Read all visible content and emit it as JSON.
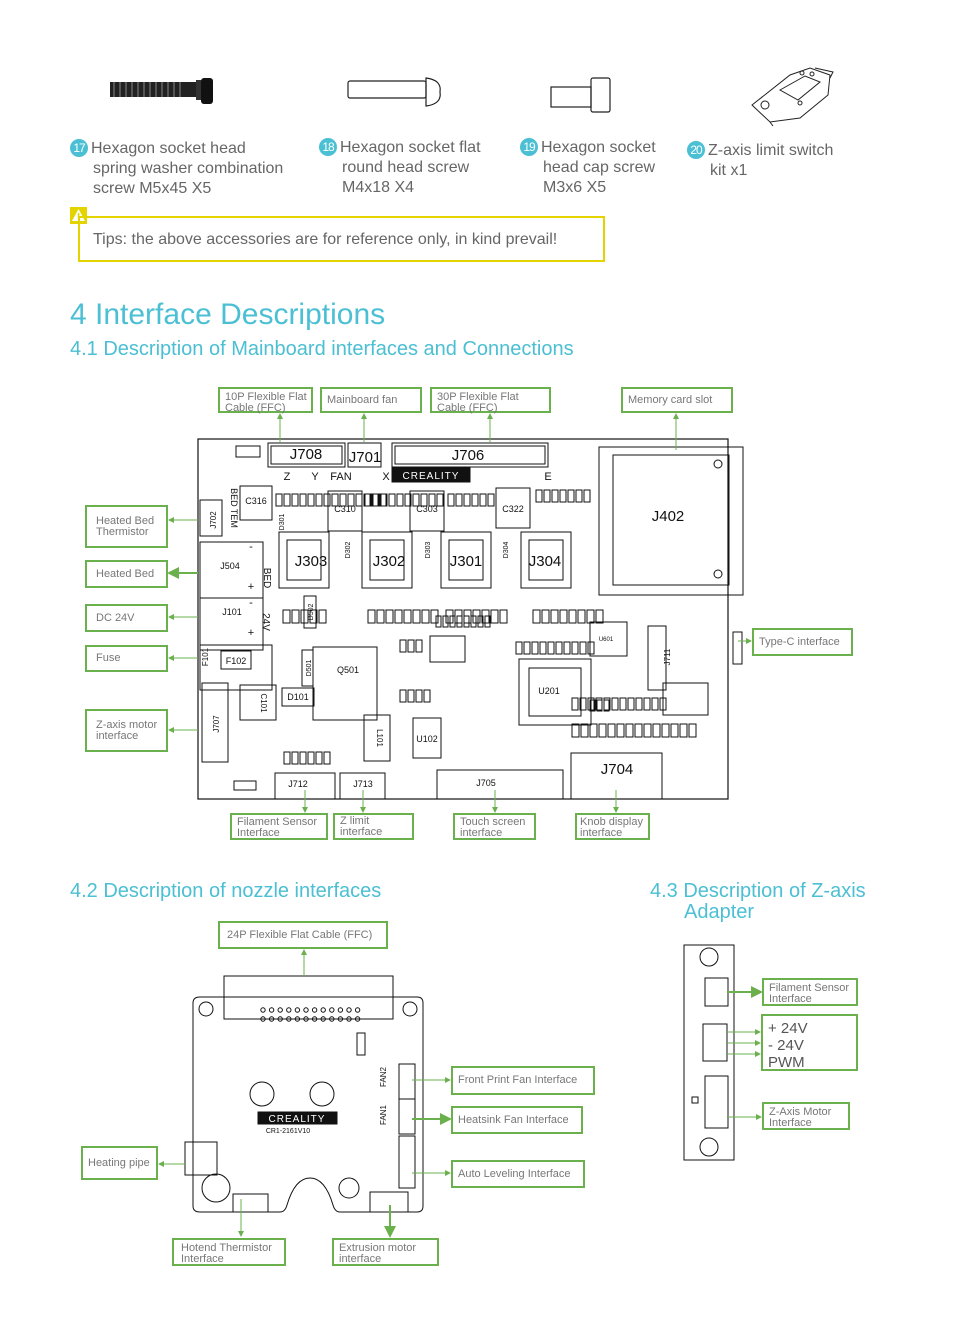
{
  "accessories": [
    {
      "number": "17",
      "lines": [
        "Hexagon socket head",
        "spring washer combination",
        "screw M5x45 X5"
      ],
      "icon": "hex-socket-washer-screw"
    },
    {
      "number": "18",
      "lines": [
        "Hexagon socket flat",
        "round head screw",
        "M4x18 X4"
      ],
      "icon": "flat-round-head-screw"
    },
    {
      "number": "19",
      "lines": [
        "Hexagon socket",
        "head cap screw",
        "M3x6 X5"
      ],
      "icon": "cap-screw"
    },
    {
      "number": "20",
      "lines": [
        "Z-axis limit switch",
        "kit x1"
      ],
      "icon": "limit-switch"
    }
  ],
  "tips": {
    "icon": "warning-icon",
    "text": "Tips: the above accessories are for reference only, in kind prevail!"
  },
  "section": {
    "title": "4 Interface Descriptions"
  },
  "mainboard": {
    "title": "4.1 Description of Mainboard interfaces and Connections",
    "labels": {
      "ffc10": [
        "10P Flexible Flat",
        "Cable (FFC)"
      ],
      "fan": "Mainboard fan",
      "ffc30": [
        "30P Flexible Flat",
        "Cable (FFC)"
      ],
      "memory": "Memory card slot",
      "bed_therm": [
        "Heated Bed",
        "Thermistor"
      ],
      "bed": "Heated Bed",
      "dc": "DC 24V",
      "fuse": "Fuse",
      "zmotor": [
        "Z-axis motor",
        "interface"
      ],
      "typec": "Type-C interface",
      "filament": [
        "Filament Sensor",
        "Interface"
      ],
      "zlimit": "Z limit interface",
      "touch": [
        "Touch screen",
        "interface"
      ],
      "knob": [
        "Knob display",
        "interface"
      ]
    },
    "silk": {
      "J708": "J708",
      "J701": "J701",
      "J706": "J706",
      "J402": "J402",
      "J303": "J303",
      "J302": "J302",
      "J301": "J301",
      "J304": "J304",
      "C316": "C316",
      "C310": "C310",
      "C303": "C303",
      "C322": "C322",
      "J504": "J504",
      "J101": "J101",
      "F102": "F102",
      "F101": "F101",
      "Q501": "Q501",
      "D501": "D501",
      "D502": "D502",
      "U201": "U201",
      "U601": "U601",
      "J711": "J711",
      "D101": "D101",
      "C101": "C101",
      "J707": "J707",
      "J702": "J702",
      "L101": "L101",
      "U102": "U102",
      "J712": "J712",
      "J713": "J713",
      "J705": "J705",
      "J704": "J704",
      "D301": "D301",
      "D302": "D302",
      "D303": "D303",
      "D304": "D304",
      "Z": "Z",
      "Y": "Y",
      "FAN": "FAN",
      "X": "X",
      "E": "E",
      "BED_TEM": "BED TEM",
      "BED": "BED",
      "V24": "24V",
      "plus": "+",
      "minus": "-",
      "logo": "CREALITY"
    }
  },
  "nozzle": {
    "title": "4.2 Description of nozzle interfaces",
    "labels": {
      "ffc24": "24P Flexible Flat Cable (FFC)",
      "front_fan": "Front Print Fan Interface",
      "heatsink_fan": "Heatsink Fan Interface",
      "auto_level": "Auto Leveling Interface",
      "heating_pipe": "Heating pipe",
      "thermistor": [
        "Hotend Thermistor",
        "Interface"
      ],
      "extrusion": [
        "Extrusion motor",
        "interface"
      ]
    },
    "silk": {
      "logo": "CREALITY",
      "model": "CR1-2161V10",
      "fan2": "FAN2",
      "fan1": "FAN1"
    }
  },
  "zadapter": {
    "title": [
      "4.3 Description of Z-axis",
      "Adapter"
    ],
    "labels": {
      "filament": [
        "Filament Sensor",
        "Interface"
      ],
      "power": [
        "+ 24V",
        "- 24V",
        "PWM"
      ],
      "zmotor": [
        "Z-Axis Motor",
        "Interface"
      ]
    }
  },
  "colors": {
    "accent": "#4bbfd3",
    "label_border": "#6ab04c",
    "warning": "#e3d400"
  }
}
